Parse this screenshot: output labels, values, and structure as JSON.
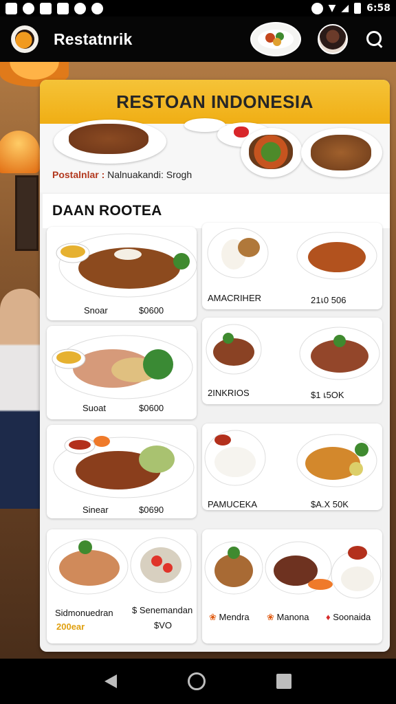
{
  "status_bar": {
    "time": "6:58"
  },
  "app_bar": {
    "title": "Restatnrik"
  },
  "card": {
    "banner_title": "RESTOAN INDONESIA",
    "info": {
      "label": "Postalnlar :",
      "value": "Nalnuakandi: Srogh"
    },
    "section_title": "DAAN ROOTEA"
  },
  "left_tiles": [
    {
      "name": "Snoar",
      "price": "$0600"
    },
    {
      "name": "Suoat",
      "price": "$0600"
    },
    {
      "name": "Sinear",
      "price": "$0690"
    },
    {
      "name": "Sidmonuedran",
      "price": "200ear"
    }
  ],
  "right_tiles": [
    {
      "name": "AMACRIHER",
      "price": "21เ0 506"
    },
    {
      "name": "2INKRIOS",
      "price": "$1 เ5OK"
    },
    {
      "name": "PAMUCEKA",
      "price": "$A.X 50K"
    }
  ],
  "bottom_left_tile": {
    "right_caption": "$ Senemandan",
    "right_price": "$VO"
  },
  "bottom_right_tile": {
    "labels": [
      "Mendra",
      "Manona",
      "Soonaida"
    ]
  },
  "colors": {
    "banner": "#f0ae14",
    "accent": "#b2381e",
    "card_bg": "#f1f1f1"
  },
  "icons": [
    "restaurant-logo-icon",
    "search-icon",
    "back-icon",
    "home-icon",
    "recents-icon"
  ]
}
